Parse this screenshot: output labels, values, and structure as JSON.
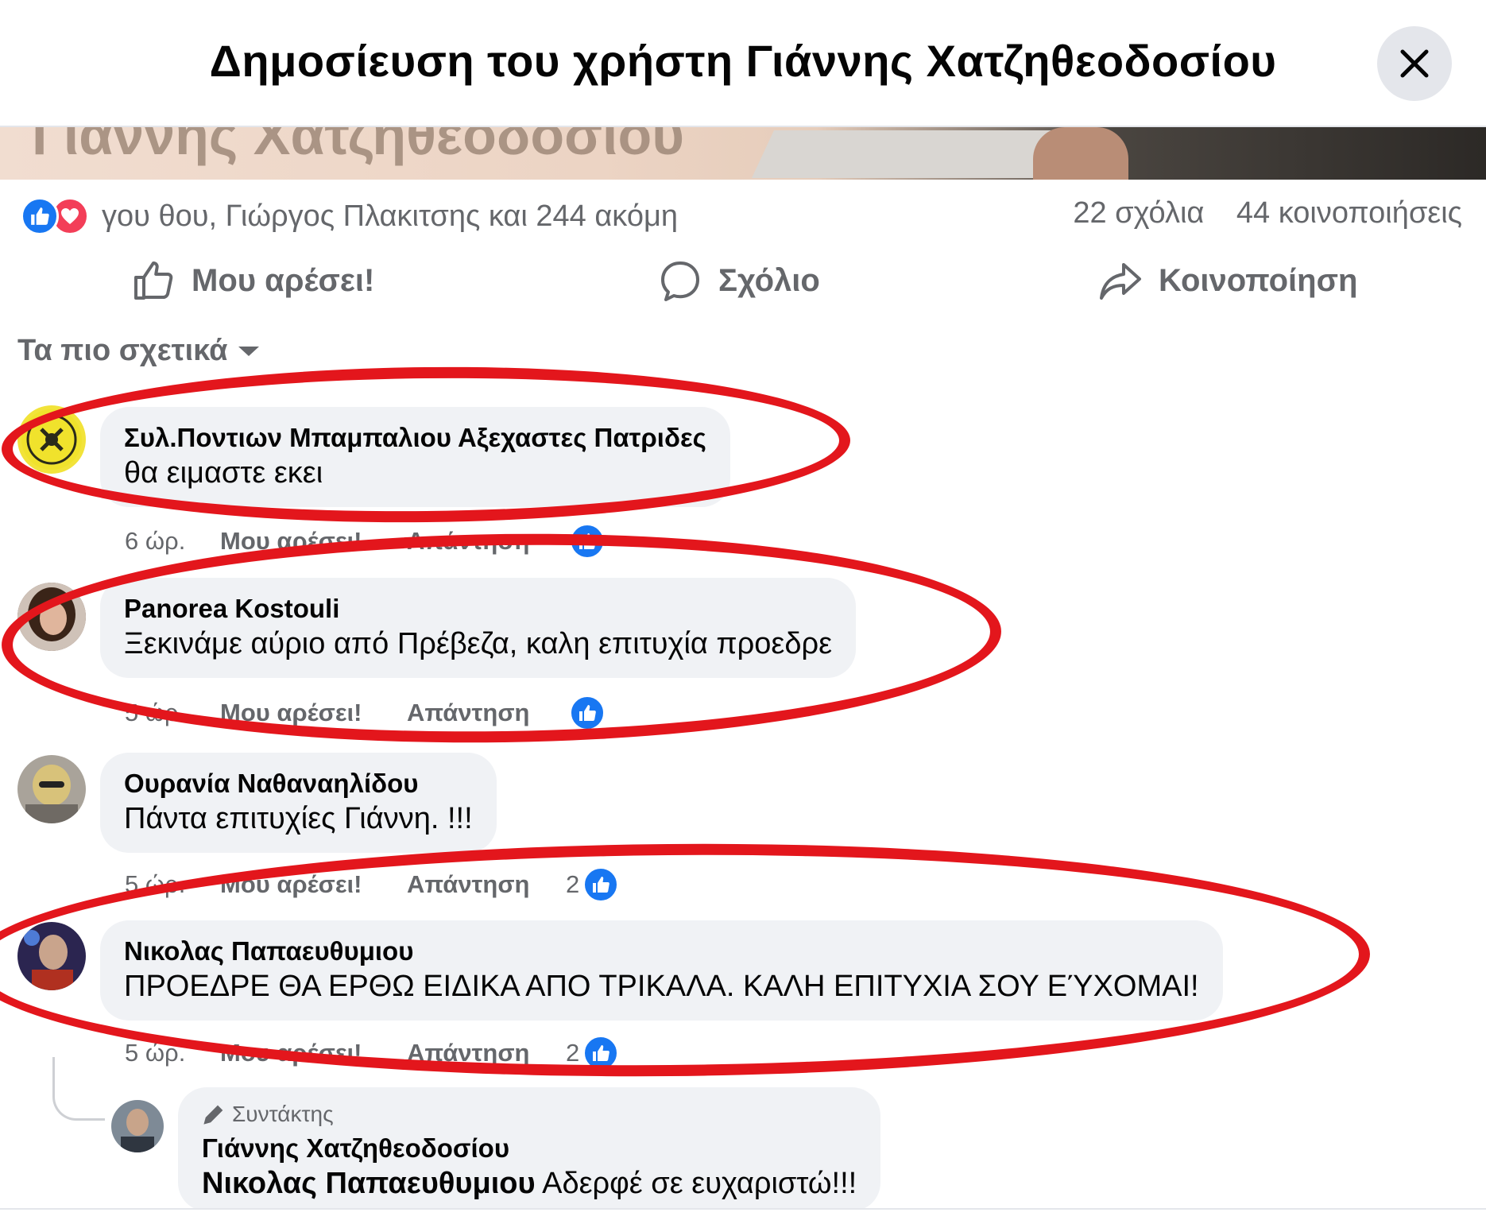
{
  "header": {
    "title": "Δημοσίευση του χρήστη Γιάννης Χατζηθεοδοσίου"
  },
  "post_image": {
    "overlay_text": "Γιάννης Χατζηθεοδοσίου"
  },
  "reactions": {
    "summary": "γου θου, Γιώργος Πλακιτσης και 244 ακόμη",
    "comments_count": "22 σχόλια",
    "shares_count": "44 κοινοποιήσεις"
  },
  "actions": {
    "like_label": "Μου αρέσει!",
    "comment_label": "Σχόλιο",
    "share_label": "Κοινοποίηση"
  },
  "sort": {
    "label": "Τα πιο σχετικά"
  },
  "comments": [
    {
      "author": "Συλ.Ποντιων Μπαμπαλιου Αξεχαστες Πατριδες",
      "text": "θα ειμαστε εκει",
      "time": "6 ώρ.",
      "like": "Μου αρέσει!",
      "reply": "Απάντηση",
      "reaction_count": ""
    },
    {
      "author": "Panorea Kostouli",
      "text": "Ξεκινάμε αύριο από Πρέβεζα, καλη επιτυχία προεδρε",
      "time": "5 ώρ.",
      "like": "Μου αρέσει!",
      "reply": "Απάντηση",
      "reaction_count": ""
    },
    {
      "author": "Ουρανία Ναθαναηλίδου",
      "text": "Πάντα επιτυχίες Γιάννη. !!!",
      "time": "5 ώρ.",
      "like": "Μου αρέσει!",
      "reply": "Απάντηση",
      "reaction_count": "2"
    },
    {
      "author": "Νικολας Παπαευθυμιου",
      "text": "ΠΡΟΕΔΡΕ ΘΑ ΕΡΘΩ ΕΙΔΙΚΑ ΑΠΟ ΤΡΙΚΑΛΑ. ΚΑΛΗ ΕΠΙΤΥΧΙΑ ΣΟΥ ΕΎΧΟΜΑΙ!",
      "time": "5 ώρ.",
      "like": "Μου αρέσει!",
      "reply": "Απάντηση",
      "reaction_count": "2"
    }
  ],
  "reply": {
    "badge": "Συντάκτης",
    "author": "Γιάννης Χατζηθεοδοσίου",
    "mention": "Νικολας Παπαευθυμιου",
    "text": "Αδερφέ σε ευχαριστώ!!!"
  },
  "colors": {
    "brand_blue": "#1877f2",
    "love_red": "#f33e58",
    "annotation_red": "#e3161c",
    "bubble_bg": "#f0f2f5",
    "secondary_text": "#65676b"
  },
  "icons": {
    "close": "close-icon",
    "like_reaction": "like-reaction-icon",
    "love_reaction": "love-reaction-icon",
    "thumbs_up": "thumbs-up-icon",
    "comment": "comment-icon",
    "share": "share-icon",
    "caret": "caret-down-icon",
    "pencil": "pencil-icon"
  }
}
